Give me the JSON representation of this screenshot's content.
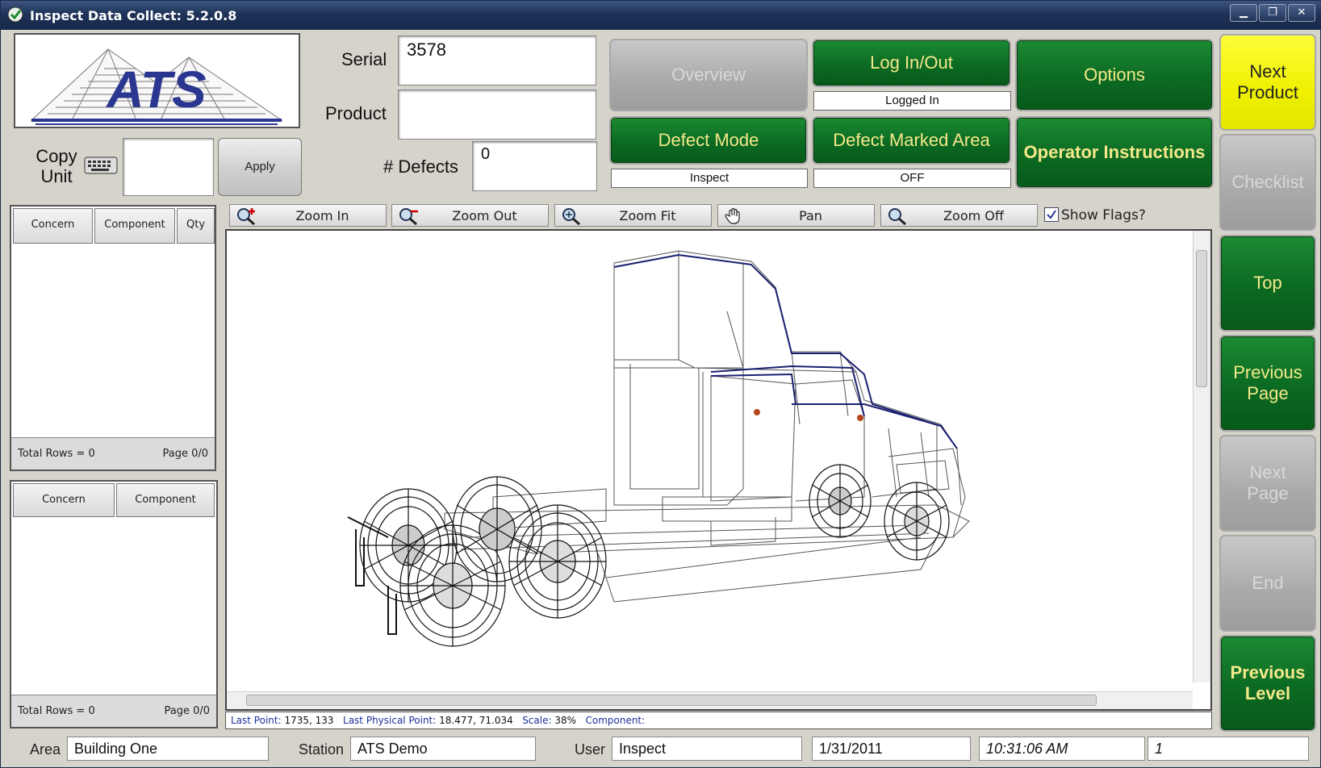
{
  "window": {
    "title": "Inspect Data Collect: 5.2.0.8",
    "controls": [
      "▁",
      "❐",
      "✕"
    ]
  },
  "header": {
    "serial_label": "Serial",
    "serial_value": "3578",
    "product_label": "Product",
    "product_value": "",
    "defects_label": "# Defects",
    "defects_value": "0",
    "copy_unit_label": "Copy Unit",
    "copy_unit_value": "",
    "apply_label": "Apply"
  },
  "buttons": {
    "overview": "Overview",
    "login": "Log In/Out",
    "login_status": "Logged In",
    "options": "Options",
    "defect_mode": "Defect Mode",
    "defect_mode_status": "Inspect",
    "defect_marked_area": "Defect Marked Area",
    "defect_marked_area_status": "OFF",
    "operator_instructions": "Operator Instructions"
  },
  "nav": {
    "next_product": "Next Product",
    "checklist": "Checklist",
    "top": "Top",
    "previous_page": "Previous Page",
    "next_page": "Next Page",
    "end": "End",
    "previous_level": "Previous Level"
  },
  "table1": {
    "columns": [
      "Concern",
      "Component",
      "Qty"
    ],
    "rows": [],
    "total": "Total Rows = 0",
    "page": "Page 0/0"
  },
  "table2": {
    "columns": [
      "Concern",
      "Component"
    ],
    "rows": [],
    "total": "Total Rows = 0",
    "page": "Page 0/0"
  },
  "toolbar": {
    "zoom_in": "Zoom In",
    "zoom_out": "Zoom Out",
    "zoom_fit": "Zoom Fit",
    "pan": "Pan",
    "zoom_off": "Zoom Off",
    "show_flags": "Show Flags?",
    "show_flags_checked": true
  },
  "info": {
    "last_point_label": "Last Point:",
    "last_point": "1735,  133",
    "last_physical_label": "Last Physical Point:",
    "last_physical": "18.477, 71.034",
    "scale_label": "Scale:",
    "scale": "38%",
    "component_label": "Component:",
    "component": ""
  },
  "statusbar": {
    "area_label": "Area",
    "area": "Building One",
    "station_label": "Station",
    "station": "ATS Demo",
    "user_label": "User",
    "user": "Inspect",
    "date": "1/31/2011",
    "time": "10:31:06 AM",
    "count": "1"
  },
  "colors": {
    "green": "#0c6a22",
    "yellow_text": "#f4e98a",
    "next_product_bg": "#f0f000",
    "title_bar": "#1e3258"
  },
  "logo_text": "ATS"
}
